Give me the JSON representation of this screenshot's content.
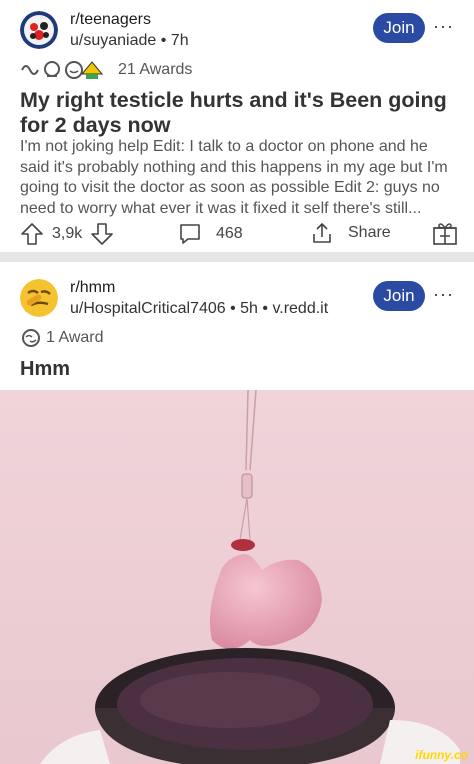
{
  "post1": {
    "subreddit": "r/teenagers",
    "user": "u/suyaniade",
    "time": "7h",
    "join_label": "Join",
    "more_label": "···",
    "awards_count": "21 Awards",
    "title": "My right testicle hurts and it's Been going for 2 days now",
    "body": "I'm not joking help Edit: I talk to a doctor on phone and he said it's probably nothing and this happens in my age but I'm going to visit the doctor as soon as possible Edit 2: guys no need to worry what ever it was it fixed it self there's still...",
    "upvotes": "3,9k",
    "comments": "468",
    "share_label": "Share"
  },
  "post2": {
    "subreddit": "r/hmm",
    "user": "u/HospitalCritical7406",
    "time": "5h",
    "domain": "v.redd.it",
    "join_label": "Join",
    "more_label": "···",
    "awards_count": "1 Award",
    "title": "Hmm"
  },
  "watermark": "ifunny.co",
  "colors": {
    "join_bg": "#2b4aa3",
    "divider": "#e6e6e6",
    "image_bg": "#f2d6dc",
    "watermark": "#ffd800"
  },
  "icons": [
    "upvote-icon",
    "downvote-icon",
    "comment-icon",
    "share-icon",
    "award-add-icon"
  ]
}
